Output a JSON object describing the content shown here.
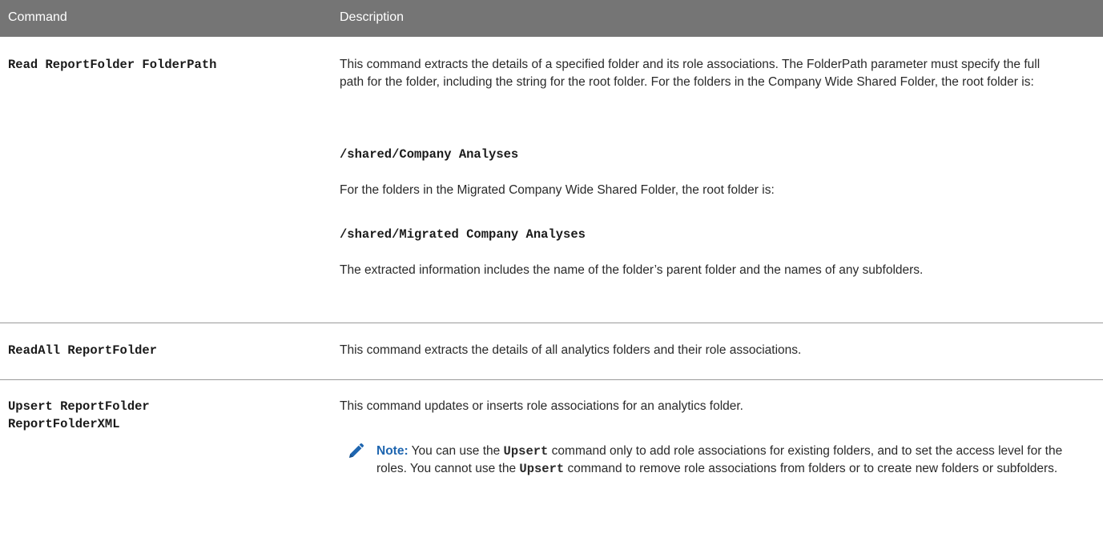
{
  "header": {
    "col1": "Command",
    "col2": "Description"
  },
  "rows": [
    {
      "command": "Read ReportFolder FolderPath",
      "desc1": "This command extracts the details of a specified folder and its role associations. The FolderPath parameter must specify the full path for the folder, including the string for the root folder. For the folders in the Company Wide Shared Folder, the root folder is:",
      "code1": "/shared/Company Analyses",
      "desc2": "For the folders in the Migrated Company Wide Shared Folder, the root folder is:",
      "code2": "/shared/Migrated Company Analyses",
      "desc3": "The extracted information includes the name of the folder’s parent folder and the names of any subfolders."
    },
    {
      "command": "ReadAll ReportFolder",
      "desc1": "This command extracts the details of all analytics folders and their role associations."
    },
    {
      "command_line1": "Upsert ReportFolder",
      "command_line2": "ReportFolderXML",
      "desc1": "This command updates or inserts role associations for an analytics folder.",
      "note": {
        "icon": "pencil-icon",
        "label": "Note:",
        "t1": " You can use the ",
        "code1": "Upsert",
        "t2": " command only to add role associations for existing folders, and to set the access level for the roles. You cannot use the ",
        "code2": "Upsert",
        "t3": " command to remove role associations from folders or to create new folders or subfolders."
      }
    }
  ]
}
